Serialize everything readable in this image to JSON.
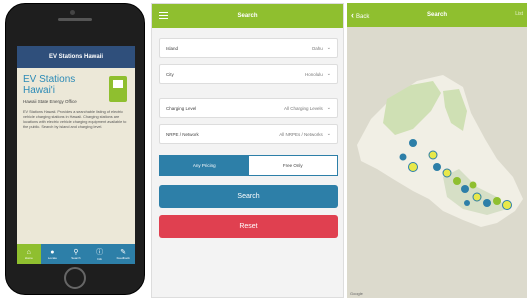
{
  "app": {
    "header": "EV Stations Hawaii",
    "title": "EV Stations Hawai'i",
    "office": "Hawaii State Energy Office",
    "description": "EV Stations Hawaii. Provides a searchable listing of electric vehicle charging stations in Hawaii. Charging stations are locations with electric vehicle charging equipment available to the public. Search by island and charging level."
  },
  "nav": [
    {
      "icon": "home-icon",
      "label": "Home"
    },
    {
      "icon": "pin-icon",
      "label": "Locate"
    },
    {
      "icon": "search-icon",
      "label": "Search"
    },
    {
      "icon": "info-icon",
      "label": "Info"
    },
    {
      "icon": "feedback-icon",
      "label": "Feedback"
    }
  ],
  "search": {
    "title": "Search",
    "fields": [
      {
        "label": "Island",
        "value": "Oahu"
      },
      {
        "label": "City",
        "value": "Honolulu"
      },
      {
        "label": "Charging Level",
        "value": "All Charging Levels"
      },
      {
        "label": "NRPE / Network",
        "value": "All NRPEs / Networks"
      }
    ],
    "pricing": {
      "left": "Any Pricing",
      "right": "Free Only"
    },
    "search_button": "Search",
    "reset_button": "Reset"
  },
  "map": {
    "title": "Search",
    "back_label": "Back",
    "right_label": "List",
    "attribution": "Google"
  },
  "colors": {
    "green": "#8fbf2f",
    "blue": "#2d7fa8",
    "red": "#e04050",
    "navy": "#2f4f7b"
  }
}
